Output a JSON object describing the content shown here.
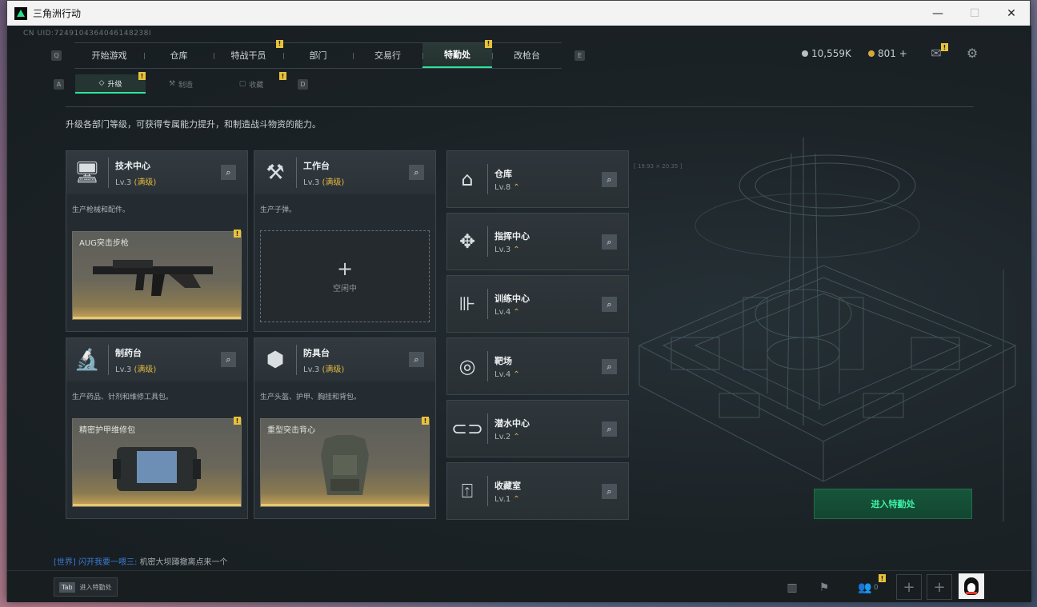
{
  "window": {
    "title": "三角洲行动",
    "minimize": "—",
    "maximize": "☐",
    "close": "✕"
  },
  "uid": "CN UID:7249104364046148238I",
  "nav": {
    "left_key": "Q",
    "right_key": "E",
    "tabs": [
      {
        "label": "开始游戏",
        "badge": ""
      },
      {
        "label": "仓库",
        "badge": ""
      },
      {
        "label": "特战干员",
        "badge": "!"
      },
      {
        "label": "部门",
        "badge": ""
      },
      {
        "label": "交易行",
        "badge": ""
      },
      {
        "label": "特勤处",
        "badge": "!",
        "active": true
      },
      {
        "label": "改枪台",
        "badge": ""
      }
    ]
  },
  "currency": {
    "coins": "10,559K",
    "tickets": "801 +"
  },
  "subnav": {
    "left_key": "A",
    "right_key": "D",
    "tabs": [
      {
        "label": "升级",
        "icon": "upgrade-icon",
        "badge": "!",
        "active": true
      },
      {
        "label": "制造",
        "icon": "craft-icon",
        "badge": ""
      },
      {
        "label": "收藏",
        "icon": "collection-icon",
        "badge": "!"
      }
    ]
  },
  "description": "升级各部门等级，可获得专属能力提升，和制造战斗物资的能力。",
  "production_cards": [
    {
      "name": "技术中心",
      "level": "Lv.3",
      "max": "(满级)",
      "text": "生产枪械和配件。",
      "slot": "AUG突击步枪",
      "slot_badge": "!"
    },
    {
      "name": "工作台",
      "level": "Lv.3",
      "max": "(满级)",
      "text": "生产子弹。",
      "slot_empty": "空闲中",
      "plus": "+"
    },
    {
      "name": "制药台",
      "level": "Lv.3",
      "max": "(满级)",
      "text": "生产药品、针剂和维修工具包。",
      "slot": "精密护甲维修包",
      "slot_badge": "!"
    },
    {
      "name": "防具台",
      "level": "Lv.3",
      "max": "(满级)",
      "text": "生产头盔、护甲、胸挂和背包。",
      "slot": "重型突击背心",
      "slot_badge": "!"
    }
  ],
  "facility_cards": [
    {
      "name": "仓库",
      "level": "Lv.8"
    },
    {
      "name": "指挥中心",
      "level": "Lv.3"
    },
    {
      "name": "训练中心",
      "level": "Lv.4"
    },
    {
      "name": "靶场",
      "level": "Lv.4"
    },
    {
      "name": "潜水中心",
      "level": "Lv.2"
    },
    {
      "name": "收藏室",
      "level": "Lv.1"
    }
  ],
  "enter_button": "进入特勤处",
  "chat": {
    "channel": "[世界]",
    "sender": "闪开我要一喂三:",
    "message": "机密大坝蹲撤离点来一个"
  },
  "bottom": {
    "tab_key": "Tab",
    "tab_label": "进入特勤处",
    "friends_count": "0",
    "friends_badge": "!"
  },
  "range_text": "[ 19.93 × 20.35 ]"
}
